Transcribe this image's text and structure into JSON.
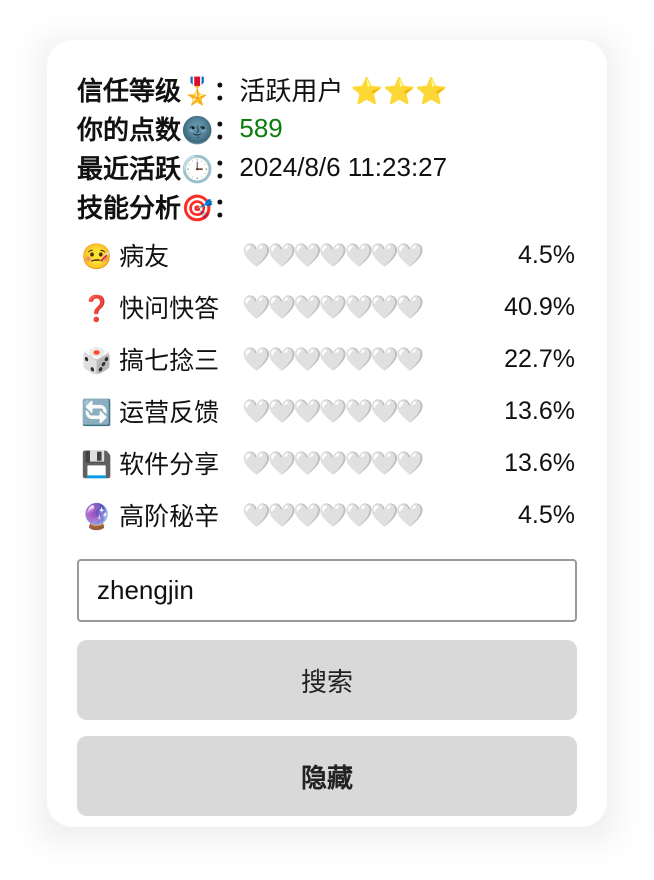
{
  "profile": {
    "trust_label": "信任等级🎖️：",
    "trust_value": "活跃用户 ⭐⭐⭐",
    "points_label": "你的点数🌚：",
    "points_value": "589",
    "recent_label": "最近活跃🕒：",
    "recent_value": "2024/8/6 11:23:27",
    "skill_label": "技能分析🎯："
  },
  "skills": [
    {
      "icon": "🤒",
      "name": "病友",
      "hearts": "🤍🤍🤍🤍🤍🤍🤍",
      "pct": "4.5%"
    },
    {
      "icon": "❓",
      "name": "快问快答",
      "hearts": "🤍🤍🤍🤍🤍🤍🤍",
      "pct": "40.9%"
    },
    {
      "icon": "🎲",
      "name": "搞七捻三",
      "hearts": "🤍🤍🤍🤍🤍🤍🤍",
      "pct": "22.7%"
    },
    {
      "icon": "🔄",
      "name": "运营反馈",
      "hearts": "🤍🤍🤍🤍🤍🤍🤍",
      "pct": "13.6%"
    },
    {
      "icon": "💾",
      "name": "软件分享",
      "hearts": "🤍🤍🤍🤍🤍🤍🤍",
      "pct": "13.6%"
    },
    {
      "icon": "🔮",
      "name": "高阶秘辛",
      "hearts": "🤍🤍🤍🤍🤍🤍🤍",
      "pct": "4.5%"
    }
  ],
  "search": {
    "value": "zhengjin"
  },
  "buttons": {
    "search_label": "搜索",
    "hide_label": "隐藏"
  }
}
